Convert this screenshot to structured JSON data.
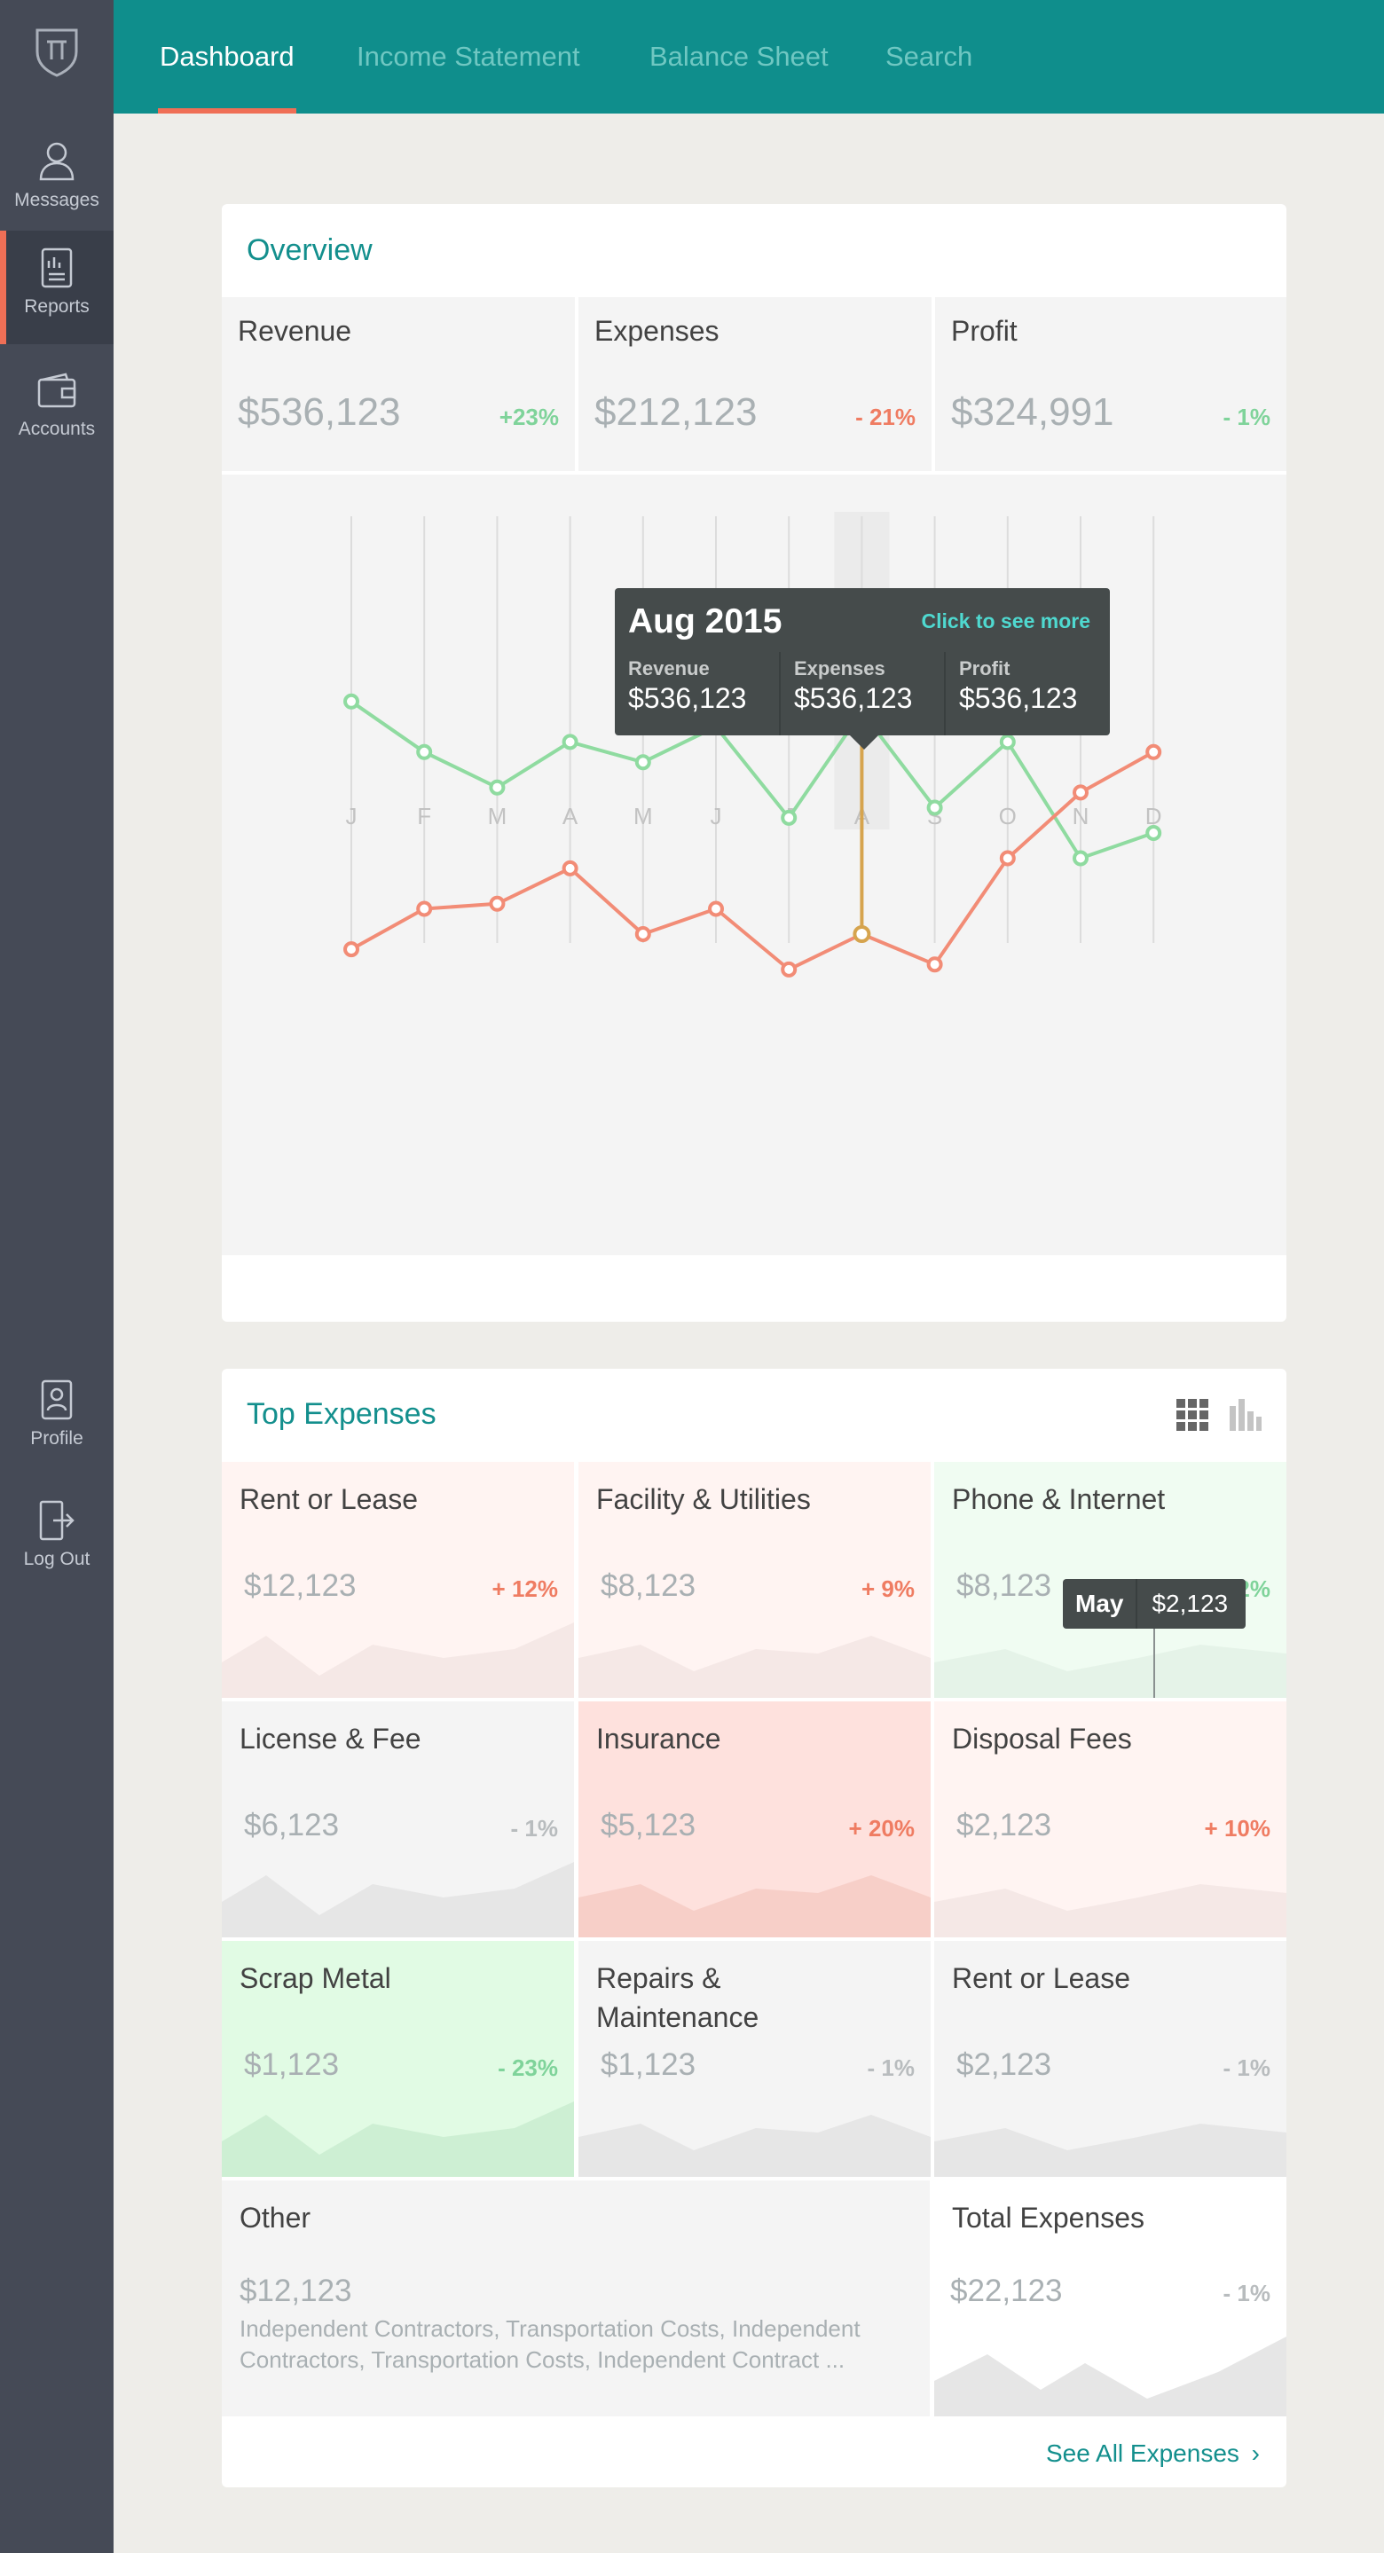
{
  "sidebar": {
    "items": [
      {
        "label": "Messages",
        "icon": "user-icon"
      },
      {
        "label": "Reports",
        "icon": "report-icon"
      },
      {
        "label": "Accounts",
        "icon": "wallet-icon"
      }
    ],
    "bottom_items": [
      {
        "label": "Profile",
        "icon": "profile-icon"
      },
      {
        "label": "Log Out",
        "icon": "logout-icon"
      }
    ]
  },
  "topbar": {
    "tabs": [
      "Dashboard",
      "Income Statement",
      "Balance Sheet",
      "Search"
    ],
    "active_tab": "Dashboard"
  },
  "overview": {
    "title": "Overview",
    "stats": [
      {
        "label": "Revenue",
        "value": "$536,123",
        "change": "+23%",
        "trend": "up"
      },
      {
        "label": "Expenses",
        "value": "$212,123",
        "change": "- 21%",
        "trend": "down"
      },
      {
        "label": "Profit",
        "value": "$324,991",
        "change": "- 1%",
        "trend": "up"
      }
    ],
    "tooltip": {
      "title": "Aug 2015",
      "link": "Click to see more",
      "items": [
        {
          "label": "Revenue",
          "value": "$536,123"
        },
        {
          "label": "Expenses",
          "value": "$536,123"
        },
        {
          "label": "Profit",
          "value": "$536,123"
        }
      ]
    }
  },
  "chart_data": {
    "type": "line",
    "x": [
      "J",
      "F",
      "M",
      "A",
      "M",
      "J",
      "J",
      "A",
      "S",
      "O",
      "N",
      "D"
    ],
    "series": [
      {
        "values": [
          66,
          56,
          49,
          58,
          54,
          61,
          43,
          64,
          45,
          58,
          35,
          40
        ],
        "color": "#8fdba0"
      },
      {
        "values": [
          17,
          25,
          26,
          33,
          20,
          25,
          13,
          20,
          14,
          35,
          48,
          56
        ],
        "color": "#f28c76"
      }
    ],
    "ylim": [
      0,
      100
    ],
    "highlight_index": 7,
    "highlight_color": "#d6a44e",
    "grid": "vertical"
  },
  "top_expenses": {
    "title": "Top Expenses",
    "items": [
      {
        "label": "Rent or Lease",
        "value": "$12,123",
        "change": "+ 12%",
        "tone": "red-light"
      },
      {
        "label": "Facility & Utilities",
        "value": "$8,123",
        "change": "+ 9%",
        "tone": "red-light"
      },
      {
        "label": "Phone & Internet",
        "value": "$8,123",
        "change": "- 12%",
        "tone": "green-light"
      },
      {
        "label": "License & Fee",
        "value": "$6,123",
        "change": "- 1%",
        "tone": "neutral"
      },
      {
        "label": "Insurance",
        "value": "$5,123",
        "change": "+ 20%",
        "tone": "red"
      },
      {
        "label": "Disposal Fees",
        "value": "$2,123",
        "change": "+ 10%",
        "tone": "red-light"
      },
      {
        "label": "Scrap Metal",
        "value": "$1,123",
        "change": "- 23%",
        "tone": "green"
      },
      {
        "label": "Repairs & Maintenance",
        "value": "$1,123",
        "change": "- 1%",
        "tone": "neutral"
      },
      {
        "label": "Rent or Lease",
        "value": "$2,123",
        "change": "- 1%",
        "tone": "neutral"
      }
    ],
    "other": {
      "label": "Other",
      "value": "$12,123",
      "description": "Independent Contractors, Transportation Costs, Independent Contractors, Transportation Costs, Independent Contract  ..."
    },
    "total": {
      "label": "Total Expenses",
      "value": "$22,123",
      "change": "- 1%"
    },
    "mini_tooltip": {
      "month": "May",
      "value": "$2,123"
    },
    "see_all": "See All Expenses"
  },
  "colors": {
    "teal": "#0f8e8c",
    "accent": "#ef6f56",
    "green": "#7fd39a",
    "red": "#ef7c62"
  }
}
